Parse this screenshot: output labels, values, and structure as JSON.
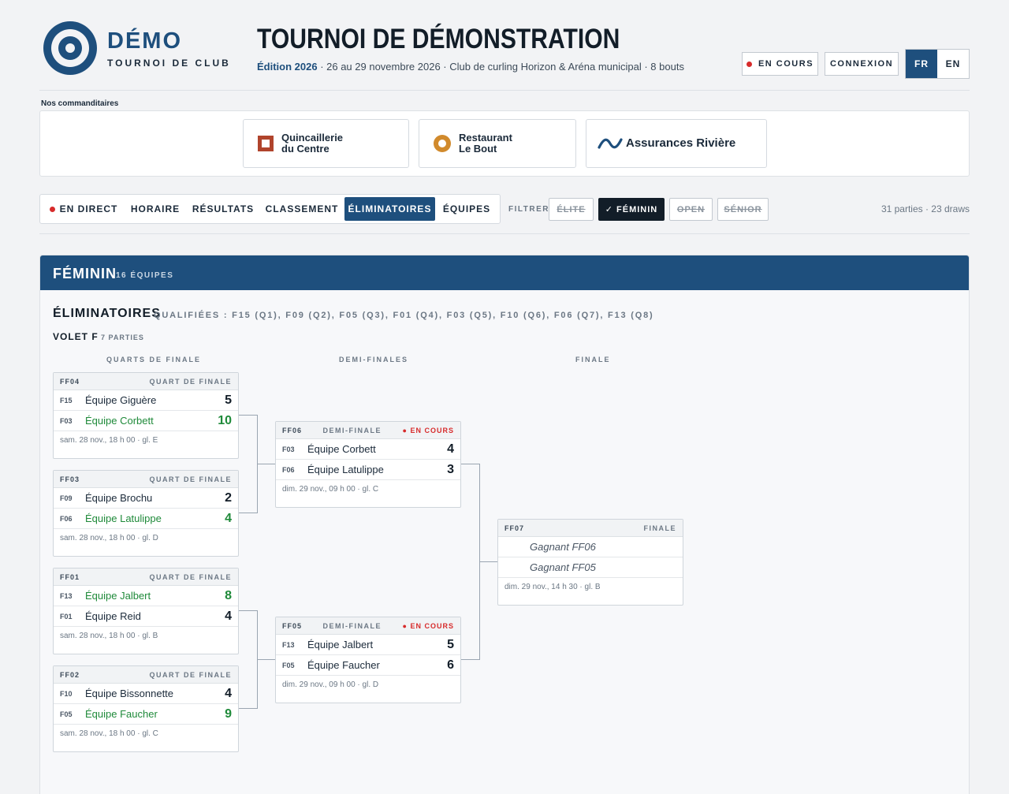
{
  "logo": {
    "title": "DÉMO",
    "subtitle": "TOURNOI DE CLUB"
  },
  "header": {
    "title": "TOURNOI DE DÉMONSTRATION",
    "edition": "Édition 2026",
    "details": " · 26 au 29 novembre 2026 · Club de curling Horizon & Aréna municipal · 8 bouts",
    "status_label": "EN COURS",
    "login_label": "CONNEXION",
    "lang_fr": "FR",
    "lang_en": "EN"
  },
  "sponsors": {
    "label": "Nos commanditaires",
    "items": [
      {
        "name1": "Quincaillerie",
        "name2": "du Centre",
        "icon": "square-icon"
      },
      {
        "name1": "Restaurant",
        "name2": "Le Bout",
        "icon": "circle-icon"
      },
      {
        "name1": "Assurances Rivière",
        "name2": "",
        "icon": "wave-icon"
      }
    ]
  },
  "nav": {
    "tabs": [
      "EN DIRECT",
      "HORAIRE",
      "RÉSULTATS",
      "CLASSEMENT",
      "ÉLIMINATOIRES",
      "ÉQUIPES"
    ],
    "active": "ÉLIMINATOIRES",
    "filter_label": "FILTRER",
    "filters": [
      "ÉLITE",
      "✓ FÉMININ",
      "OPEN",
      "SÉNIOR"
    ],
    "active_filter": "✓ FÉMININ",
    "summary": "31 parties · 23 draws"
  },
  "panel": {
    "title": "FÉMININ",
    "count": "16 ÉQUIPES",
    "section_title": "ÉLIMINATOIRES",
    "qualified": "QUALIFIÉES : F15 (Q1), F09 (Q2), F05 (Q3), F01 (Q4), F03 (Q5), F10 (Q6), F06 (Q7), F13 (Q8)",
    "volet": "VOLET F",
    "volet_count": "7 PARTIES",
    "columns": [
      "QUARTS DE FINALE",
      "DEMI-FINALES",
      "FINALE"
    ]
  },
  "matches": {
    "ff04": {
      "id": "FF04",
      "round": "QUART DE FINALE",
      "status": "",
      "rows": [
        {
          "seed": "F15",
          "team": "Équipe Giguère",
          "score": "5"
        },
        {
          "seed": "F03",
          "team": "Équipe Corbett",
          "score": "10"
        }
      ],
      "footer": "sam. 28 nov., 18 h 00 · gl. E"
    },
    "ff03": {
      "id": "FF03",
      "round": "QUART DE FINALE",
      "status": "",
      "rows": [
        {
          "seed": "F09",
          "team": "Équipe Brochu",
          "score": "2"
        },
        {
          "seed": "F06",
          "team": "Équipe Latulippe",
          "score": "4"
        }
      ],
      "footer": "sam. 28 nov., 18 h 00 · gl. D"
    },
    "ff01": {
      "id": "FF01",
      "round": "QUART DE FINALE",
      "status": "",
      "rows": [
        {
          "seed": "F13",
          "team": "Équipe Jalbert",
          "score": "8"
        },
        {
          "seed": "F01",
          "team": "Équipe Reid",
          "score": "4"
        }
      ],
      "footer": "sam. 28 nov., 18 h 00 · gl. B"
    },
    "ff02": {
      "id": "FF02",
      "round": "QUART DE FINALE",
      "status": "",
      "rows": [
        {
          "seed": "F10",
          "team": "Équipe Bissonnette",
          "score": "4"
        },
        {
          "seed": "F05",
          "team": "Équipe Faucher",
          "score": "9"
        }
      ],
      "footer": "sam. 28 nov., 18 h 00 · gl. C"
    },
    "ff06": {
      "id": "FF06",
      "round": "DEMI-FINALE",
      "status": "● EN COURS",
      "rows": [
        {
          "seed": "F03",
          "team": "Équipe Corbett",
          "score": "4"
        },
        {
          "seed": "F06",
          "team": "Équipe Latulippe",
          "score": "3"
        }
      ],
      "footer": "dim. 29 nov., 09 h 00 · gl. C"
    },
    "ff05": {
      "id": "FF05",
      "round": "DEMI-FINALE",
      "status": "● EN COURS",
      "rows": [
        {
          "seed": "F13",
          "team": "Équipe Jalbert",
          "score": "5"
        },
        {
          "seed": "F05",
          "team": "Équipe Faucher",
          "score": "6"
        }
      ],
      "footer": "dim. 29 nov., 09 h 00 · gl. D"
    },
    "ff07": {
      "id": "FF07",
      "round": "FINALE",
      "status": "",
      "rows": [
        {
          "seed": "",
          "team": "Gagnant FF06",
          "score": ""
        },
        {
          "seed": "",
          "team": "Gagnant FF05",
          "score": ""
        }
      ],
      "footer": "dim. 29 nov., 14 h 30 · gl. B"
    }
  },
  "colors": {
    "brand": "#1e4f7d",
    "winner": "#1f8a3a",
    "live": "#d72b2b"
  }
}
